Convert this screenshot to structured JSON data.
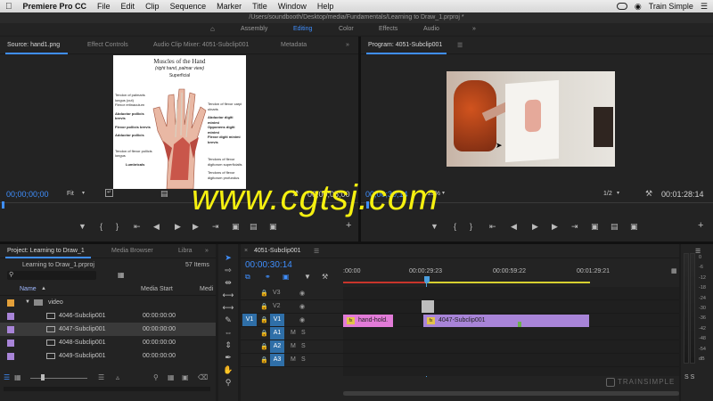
{
  "menubar": {
    "apple": "",
    "app": "Premiere Pro CC",
    "items": [
      "File",
      "Edit",
      "Clip",
      "Sequence",
      "Marker",
      "Title",
      "Window",
      "Help"
    ],
    "right_label": "Train Simple"
  },
  "titlebar": "/Users/soundbooth/Desktop/media/Fundamentals/Learning to Draw_1.prproj *",
  "workspaces": [
    "Assembly",
    "Editing",
    "Color",
    "Effects",
    "Audio"
  ],
  "source": {
    "tabs": [
      "Source: hand1.png",
      "Effect Controls",
      "Audio Clip Mixer: 4051-Subclip001",
      "Metadata"
    ],
    "timecode_in": "00;00;00;00",
    "fit": "Fit",
    "timecode_dur": "00;00;05;00",
    "image": {
      "title": "Muscles of the Hand",
      "subtitle": "(right hand, palmar view)",
      "section": "Superficial",
      "labels_left": [
        "Tendon of palmaris longus (cut)",
        "Flexor retinaculum",
        "Abductor pollicis brevis",
        "Flexor pollicis brevis",
        "Adductor pollicis",
        "Tendon of flexor pollicis longus",
        "Lumbricals"
      ],
      "labels_right": [
        "Tendon of flexor carpi ulnaris",
        "Abductor digiti minimi",
        "Opponens digiti minimi",
        "Flexor digiti minimi brevis",
        "Tendons of flexor digitorum superficialis",
        "Tendons of flexor digitorum profundus"
      ]
    }
  },
  "program": {
    "tab": "Program: 4051-Subclip001",
    "timecode": "00;00;30;14",
    "zoom": "25%",
    "fraction": "1/2",
    "duration": "00:01:28:14"
  },
  "project": {
    "tabs": [
      "Project: Learning to Draw_1",
      "Media Browser",
      "Libra"
    ],
    "file": "Learning to Draw_1.prproj",
    "count": "57 Items",
    "columns": [
      "Name",
      "Media Start",
      "Medi"
    ],
    "folder": "video",
    "items": [
      {
        "name": "4046-Subclip001",
        "start": "00:00:00:00"
      },
      {
        "name": "4047-Subclip001",
        "start": "00:00:00:00"
      },
      {
        "name": "4048-Subclip001",
        "start": "00:00:00:00"
      },
      {
        "name": "4049-Subclip001",
        "start": "00:00:00:00"
      }
    ]
  },
  "timeline": {
    "tab": "4051-Subclip001",
    "timecode": "00:00:30:14",
    "ruler": [
      ":00:00",
      "00:00:29:23",
      "00:00:59:22",
      "00:01:29:21"
    ],
    "tracks": [
      {
        "label": "V3",
        "src": ""
      },
      {
        "label": "V2",
        "src": ""
      },
      {
        "label": "V1",
        "src": "V1"
      },
      {
        "label": "A1",
        "src": ""
      },
      {
        "label": "A2",
        "src": ""
      },
      {
        "label": "A3",
        "src": ""
      }
    ],
    "clips": [
      {
        "label": "hand-hold.",
        "fx": "fx"
      },
      {
        "label": "4047-Subclip001",
        "fx": "fx"
      }
    ]
  },
  "meter": {
    "scale": [
      "0",
      "-6",
      "-12",
      "-18",
      "-24",
      "-30",
      "-36",
      "-42",
      "-48",
      "-54",
      "dB"
    ],
    "solo": "S  S"
  },
  "watermark": "www.cgtsj.com",
  "trainsimple": "TRAINSIMPLE",
  "colors": {
    "accent": "#3f8fff",
    "clip_pink": "#e27bd8",
    "clip_purple": "#a884d8",
    "playhead": "#4a9fdf",
    "watermark": "#f5f010"
  }
}
